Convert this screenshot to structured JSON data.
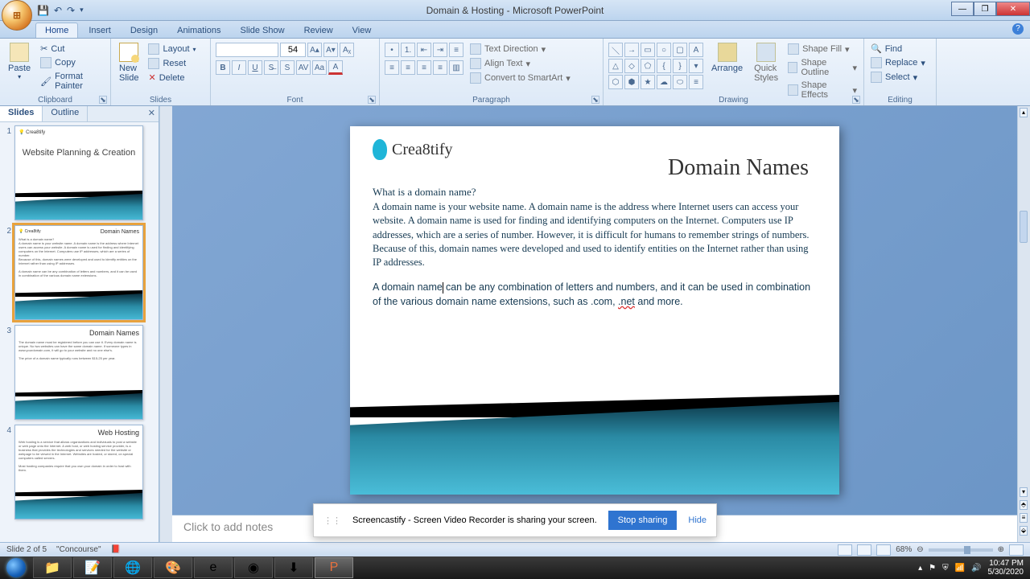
{
  "window": {
    "title": "Domain & Hosting - Microsoft PowerPoint"
  },
  "qat": {
    "save": "💾",
    "undo": "↶",
    "redo": "↷"
  },
  "tabs": [
    "Home",
    "Insert",
    "Design",
    "Animations",
    "Slide Show",
    "Review",
    "View"
  ],
  "ribbon": {
    "clipboard": {
      "label": "Clipboard",
      "paste": "Paste",
      "cut": "Cut",
      "copy": "Copy",
      "format_painter": "Format Painter"
    },
    "slides": {
      "label": "Slides",
      "new_slide": "New\nSlide",
      "layout": "Layout",
      "reset": "Reset",
      "delete": "Delete"
    },
    "font": {
      "label": "Font",
      "size": "54"
    },
    "paragraph": {
      "label": "Paragraph",
      "text_dir": "Text Direction",
      "align": "Align Text",
      "smartart": "Convert to SmartArt"
    },
    "drawing": {
      "label": "Drawing",
      "arrange": "Arrange",
      "quick": "Quick\nStyles",
      "fill": "Shape Fill",
      "outline": "Shape Outline",
      "effects": "Shape Effects"
    },
    "editing": {
      "label": "Editing",
      "find": "Find",
      "replace": "Replace",
      "select": "Select"
    }
  },
  "panel": {
    "tab_slides": "Slides",
    "tab_outline": "Outline"
  },
  "thumbs": [
    {
      "n": "1",
      "title": "Website Planning & Creation",
      "logo": "Crea8tify"
    },
    {
      "n": "2",
      "title": "Domain Names",
      "logo": "Crea8tify"
    },
    {
      "n": "3",
      "title": "Domain Names"
    },
    {
      "n": "4",
      "title": "Web Hosting"
    }
  ],
  "slide": {
    "logo": "Crea8tify",
    "title": "Domain Names",
    "q": "What is a domain name?",
    "p1": "A domain name is your website name. A domain name is the address where Internet users can access your website. A domain name is used for finding and identifying computers on the Internet. Computers use IP addresses, which are a series of number. However, it is difficult for humans to remember strings of numbers. Because of this, domain names were developed and used to identify entities on the Internet rather than using IP addresses.",
    "p2a": "A domain name",
    "p2b": "can be any combination of letters and numbers, and it can be used in combination of the various domain name extensions, such as .com, ",
    "net": ".net",
    "p2c": " and more."
  },
  "notes": {
    "placeholder": "Click to add notes"
  },
  "status": {
    "slide": "Slide 2 of 5",
    "theme": "\"Concourse\"",
    "zoom": "68%"
  },
  "share": {
    "msg": "Screencastify - Screen Video Recorder is sharing your screen.",
    "stop": "Stop sharing",
    "hide": "Hide"
  },
  "tray": {
    "time": "10:47 PM",
    "date": "5/30/2020"
  }
}
